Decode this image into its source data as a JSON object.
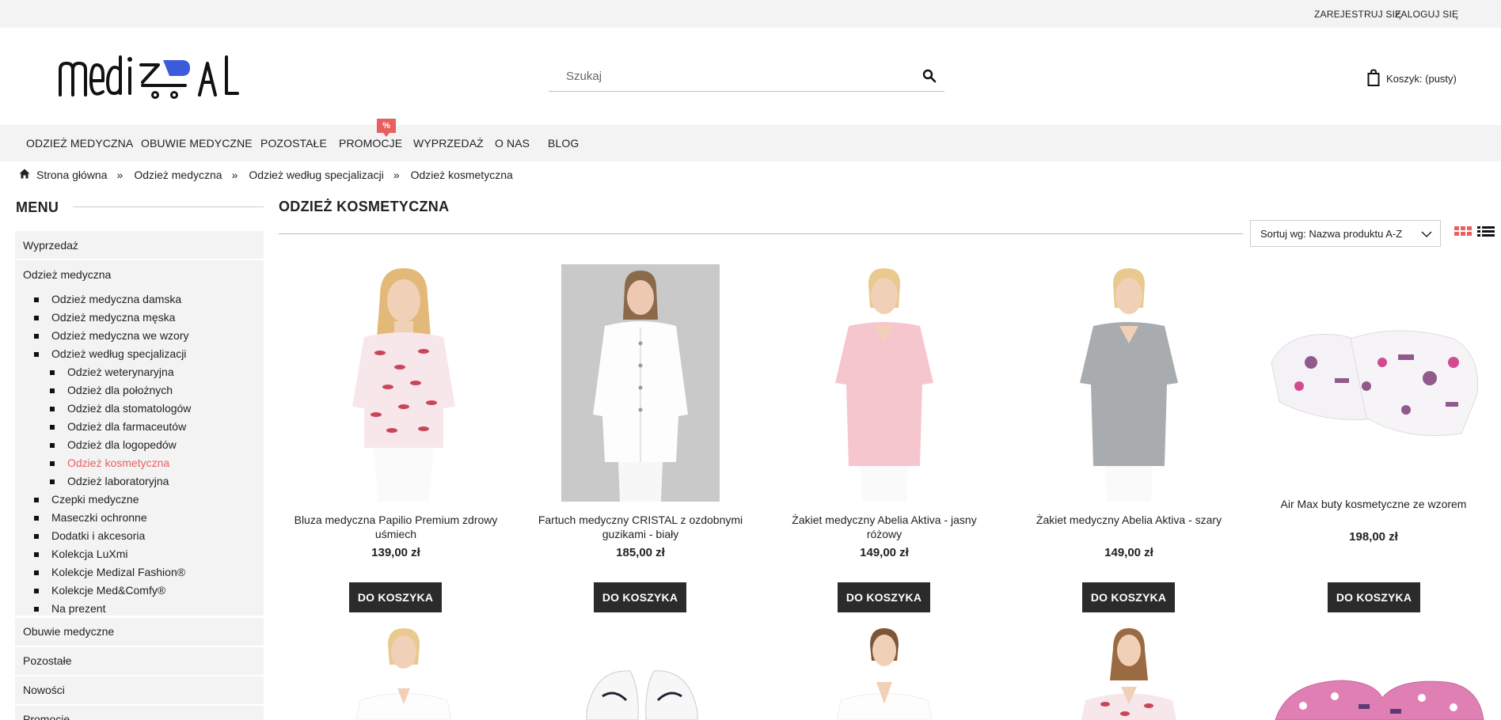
{
  "topbar": {
    "register": "ZAREJESTRUJ SIĘ",
    "login": "ZALOGUJ SIĘ"
  },
  "header": {
    "logo_text": "medizal",
    "search_placeholder": "Szukaj",
    "cart_label": "Koszyk:",
    "cart_status": "(pusty)"
  },
  "nav": {
    "items": [
      "ODZIEŻ MEDYCZNA",
      "OBUWIE MEDYCZNE",
      "POZOSTAŁE",
      "PROMOCJE",
      "WYPRZEDAŻ",
      "O NAS",
      "BLOG"
    ],
    "promo_badge": "%"
  },
  "breadcrumb": {
    "items": [
      "Strona główna",
      "Odzież medyczna",
      "Odzież według specjalizacji",
      "Odzież kosmetyczna"
    ],
    "separator": "»"
  },
  "sidebar": {
    "title": "MENU",
    "top": [
      "Wyprzedaż",
      "Odzież medyczna",
      "Obuwie medyczne",
      "Pozostałe",
      "Nowości",
      "Promocje"
    ],
    "sub": [
      "Odzież medyczna damska",
      "Odzież medyczna męska",
      "Odzież medyczna we wzory",
      "Odzież według specjalizacji",
      "Czepki medyczne",
      "Maseczki ochronne",
      "Dodatki i akcesoria",
      "Kolekcja LuXmi",
      "Kolekcje Medizal Fashion®",
      "Kolekcje Med&Comfy®",
      "Na prezent"
    ],
    "subsub": [
      "Odzież weterynaryjna",
      "Odzież dla położnych",
      "Odzież dla stomatologów",
      "Odzież dla farmaceutów",
      "Odzież dla logopedów",
      "Odzież kosmetyczna",
      "Odzież laboratoryjna"
    ]
  },
  "content": {
    "title": "ODZIEŻ KOSMETYCZNA",
    "sort_label": "Sortuj wg: Nazwa produktu A-Z",
    "add_to_cart": "DO KOSZYKA",
    "products": [
      {
        "name": "Bluza medyczna Papilio Premium zdrowy uśmiech",
        "price": "139,00 zł"
      },
      {
        "name": "Fartuch medyczny CRISTAL z ozdobnymi guzikami - biały",
        "price": "185,00 zł"
      },
      {
        "name": "Żakiet medyczny Abelia Aktiva - jasny różowy",
        "price": "149,00 zł"
      },
      {
        "name": "Żakiet medyczny Abelia Aktiva - szary",
        "price": "149,00 zł"
      },
      {
        "name": "Air Max buty kosmetyczne ze wzorem",
        "price": "198,00 zł"
      }
    ]
  },
  "colors": {
    "accent": "#e95f5f",
    "button": "#2b2b2b",
    "bar": "#f3f3f3",
    "logo_blue": "#3b5bdb"
  }
}
